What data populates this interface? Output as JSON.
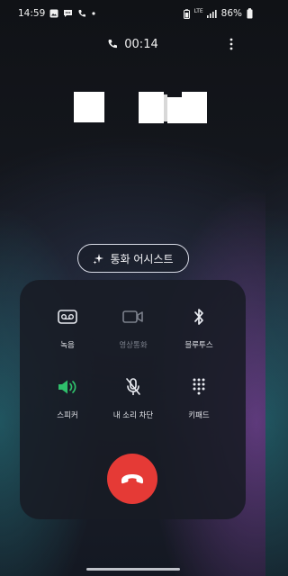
{
  "status_bar": {
    "time": "14:59",
    "network": "LTE",
    "battery": "86%",
    "left_icons": [
      "gallery-icon",
      "message-icon",
      "phone-icon",
      "dot-icon"
    ],
    "right_icons": [
      "battery-saver-icon",
      "lte-signal-icon",
      "signal-icon",
      "battery-icon"
    ]
  },
  "call": {
    "duration": "00:14",
    "assist_label": "통화 어시스트"
  },
  "controls": [
    {
      "label": "녹음",
      "icon": "voicemail-icon",
      "enabled": true
    },
    {
      "label": "영상통화",
      "icon": "video-camera-icon",
      "enabled": false
    },
    {
      "label": "블루투스",
      "icon": "bluetooth-icon",
      "enabled": true
    },
    {
      "label": "스피커",
      "icon": "speaker-icon",
      "enabled": true,
      "active": true
    },
    {
      "label": "내 소리 차단",
      "icon": "mic-off-icon",
      "enabled": true
    },
    {
      "label": "키패드",
      "icon": "keypad-icon",
      "enabled": true
    }
  ],
  "colors": {
    "end_call": "#e53a36",
    "speaker_active": "#2fbf6b",
    "disabled": "#7c818c"
  }
}
